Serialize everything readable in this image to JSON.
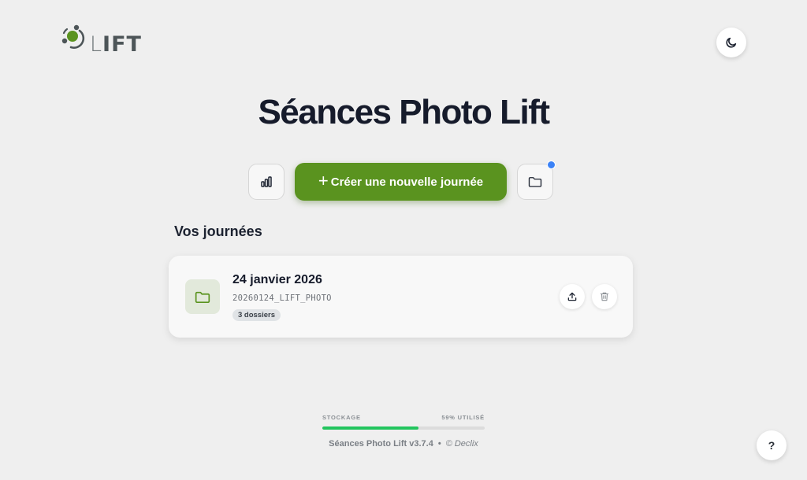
{
  "logo": {
    "text_thin": "L",
    "text_bold": "IFT"
  },
  "header": {
    "title": "Séances Photo Lift",
    "theme_icon": "moon-icon"
  },
  "actions": {
    "stats_icon": "bar-chart-icon",
    "create_plus": "+",
    "create_label": "Créer une nouvelle journée",
    "folder_icon": "folder-icon",
    "notification_color": "#3b82f6"
  },
  "days_section": {
    "title": "Vos journées",
    "items": [
      {
        "date": "24 janvier 2026",
        "code": "20260124_LIFT_PHOTO",
        "badge": "3 dossiers",
        "icon": "folder-icon",
        "actions": [
          "upload-icon",
          "trash-icon"
        ]
      }
    ]
  },
  "storage": {
    "label": "STOCKAGE",
    "usage_label": "59% UTILISÉ",
    "used_fraction": 0.59
  },
  "footer": {
    "version": "Séances Photo Lift v3.7.4",
    "separator": "•",
    "credit": "© Declix"
  },
  "help": {
    "label": "?"
  },
  "colors": {
    "accent": "#5a931f",
    "background": "#efefef",
    "storage_fill": "#22c55e",
    "title": "#161b2b"
  }
}
